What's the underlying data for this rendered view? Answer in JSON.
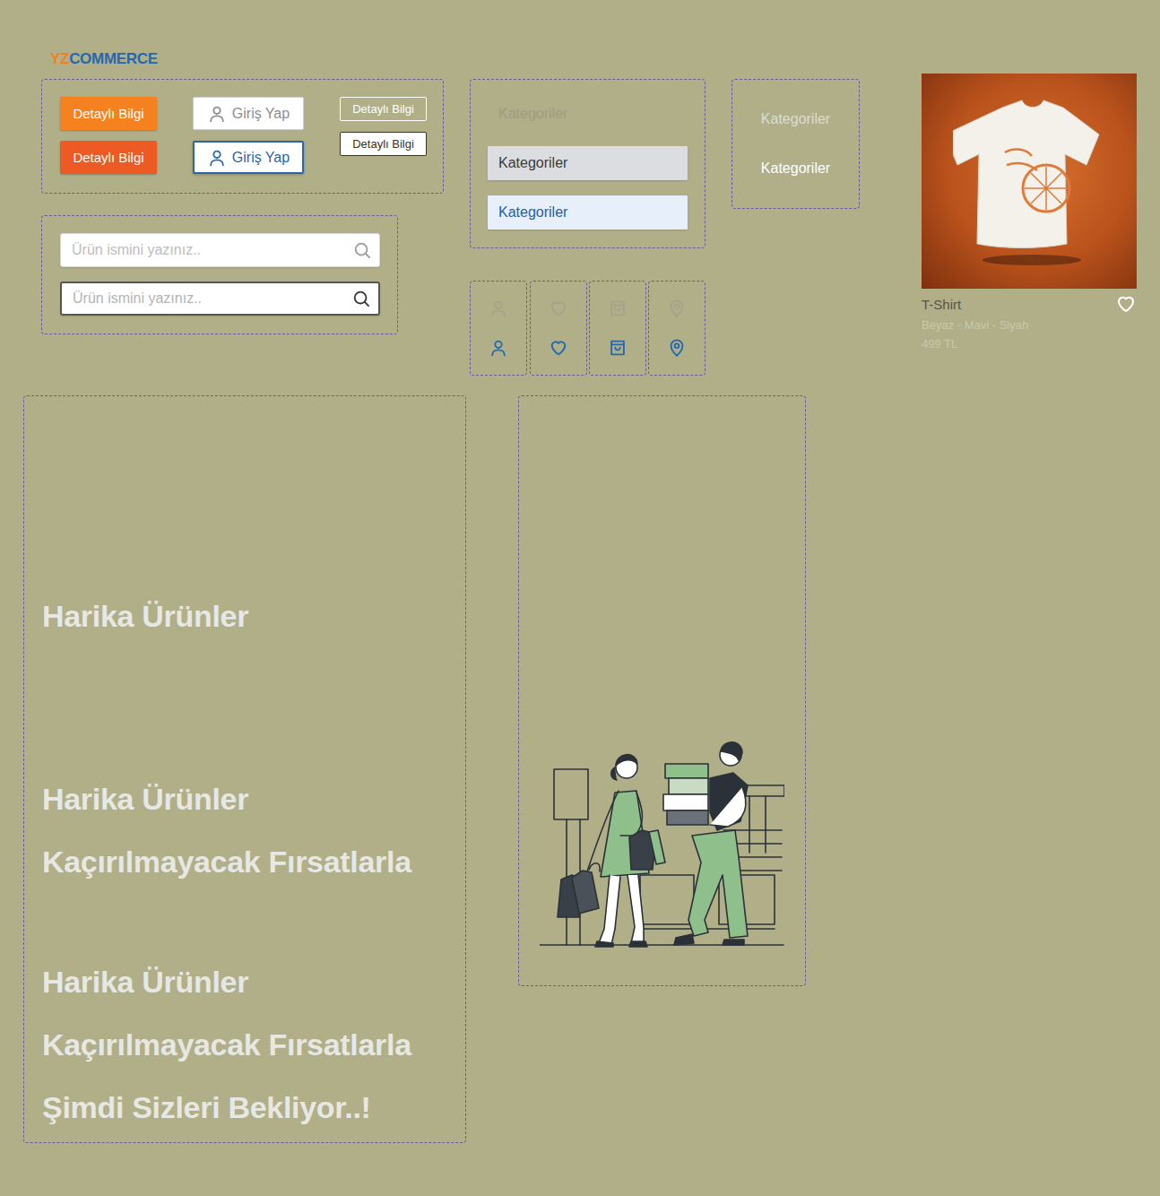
{
  "logo": {
    "prefix": "YZ",
    "name": "COMMERCE"
  },
  "buttons": [
    {
      "label": "Detaylı Bilgi",
      "kind": "solid",
      "hovered": false
    },
    {
      "label": "Detaylı Bilgi",
      "kind": "solid",
      "hovered": true
    },
    {
      "label": "Giriş Yap",
      "kind": "login",
      "hovered": false
    },
    {
      "label": "Giriş Yap",
      "kind": "login",
      "hovered": true
    },
    {
      "label": "Detaylı Bilgi",
      "kind": "outline",
      "hovered": false
    },
    {
      "label": "Detaylı Bilgi",
      "kind": "outline",
      "hovered": true
    }
  ],
  "menu_items": [
    {
      "label": "Kategoriler",
      "hovered": false,
      "selected": false
    },
    {
      "label": "Kategoriler",
      "hovered": true,
      "selected": false
    },
    {
      "label": "Kategoriler",
      "hovered": false,
      "selected": true
    }
  ],
  "dark_menu_items": [
    {
      "label": "Kategoriler",
      "selected": false
    },
    {
      "label": "Kategoriler",
      "selected": true
    }
  ],
  "search_fields": [
    {
      "placeholder": "Ürün ismini yazınız..",
      "focused": false
    },
    {
      "placeholder": "Ürün ismini yazınız..",
      "focused": true
    }
  ],
  "icon_groups": [
    {
      "kind": "user",
      "states": [
        {
          "active": false
        },
        {
          "active": true
        }
      ]
    },
    {
      "kind": "heart",
      "states": [
        {
          "active": false
        },
        {
          "active": true
        }
      ]
    },
    {
      "kind": "bag",
      "states": [
        {
          "active": false
        },
        {
          "active": true
        }
      ]
    },
    {
      "kind": "pin",
      "states": [
        {
          "active": false
        },
        {
          "active": true
        }
      ]
    }
  ],
  "product": {
    "title": "T-Shirt",
    "colors": "Beyaz - Mavi - Siyah",
    "price": "499 TL",
    "favorite": false
  },
  "hero_groups": [
    {
      "lines": [
        "Harika Ürünler"
      ]
    },
    {
      "lines": [
        "Harika Ürünler",
        "Kaçırılmayacak Fırsatlarla"
      ]
    },
    {
      "lines": [
        "Harika Ürünler",
        "Kaçırılmayacak Fırsatlarla",
        "Şimdi Sizleri Bekliyor..!"
      ]
    }
  ]
}
